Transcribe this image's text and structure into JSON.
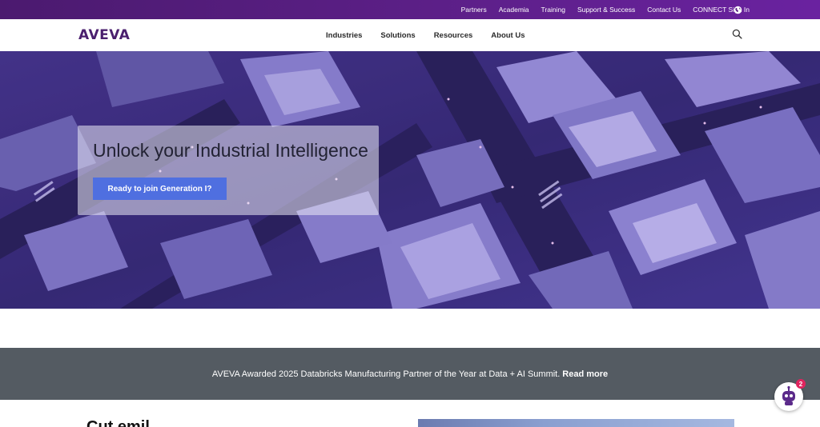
{
  "utility_bar": {
    "links": [
      "Partners",
      "Academia",
      "Training",
      "Support & Success",
      "Contact Us",
      "CONNECT Sign In"
    ],
    "globe_icon": "globe-icon"
  },
  "nav": {
    "logo": "AVEVA",
    "items": [
      "Industries",
      "Solutions",
      "Resources",
      "About Us"
    ],
    "search_icon": "search-icon"
  },
  "hero": {
    "title": "Unlock your Industrial Intelligence",
    "cta_label": "Ready to join Generation I?"
  },
  "announcement": {
    "text": "AVEVA Awarded 2025 Databricks Manufacturing Partner of the Year at Data + AI Summit.",
    "link_label": "Read more"
  },
  "below": {
    "heading": "Cut emil"
  },
  "chatbot": {
    "badge_count": "2",
    "icon": "robot-icon"
  },
  "colors": {
    "utility_bar": "#5b1f86",
    "brand": "#4a1f6e",
    "cta": "#4f6fe0",
    "announcement_bg": "#545b62"
  }
}
